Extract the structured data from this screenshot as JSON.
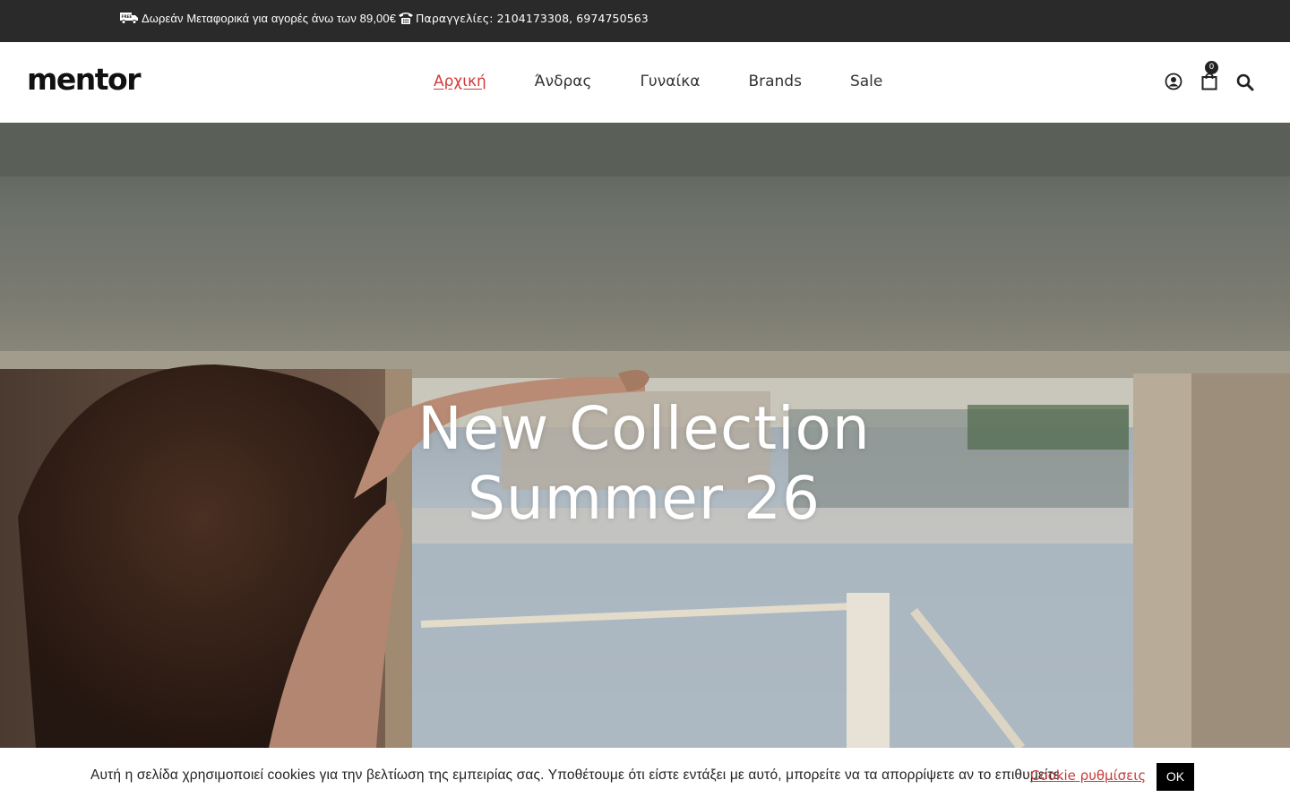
{
  "topbar": {
    "shipping_icon": "free-shipping-truck-icon",
    "shipping_text": "Δωρεάν Μεταφορικά για αγορές άνω των 89,00€",
    "phone_icon": "phone-icon",
    "orders_text": "Παραγγελίες: 2104173308, 6974750563",
    "background": "#2a2a2a"
  },
  "header": {
    "logo": "mentor",
    "nav": [
      {
        "label": "Αρχική",
        "active": true
      },
      {
        "label": "Άνδρας",
        "active": false
      },
      {
        "label": "Γυναίκα",
        "active": false
      },
      {
        "label": "Brands",
        "active": false
      },
      {
        "label": "Sale",
        "active": false
      }
    ],
    "icons": [
      "user-icon",
      "shopping-bag-icon",
      "search-icon"
    ],
    "cart_count": "0",
    "accent": "#d23a3a"
  },
  "hero": {
    "title_line1": "New Collection",
    "title_line2": "Summer 26"
  },
  "cookie_bar": {
    "message": "Αυτή η σελίδα χρησιμοποιεί cookies για την βελτίωση της εμπειρίας σας. Υποθέτουμε ότι είστε εντάξει με αυτό, μπορείτε να τα απορρίψετε αν το επιθυμείτε.",
    "settings_link": "Cookie ρυθμίσεις",
    "ok_button": "OK"
  }
}
